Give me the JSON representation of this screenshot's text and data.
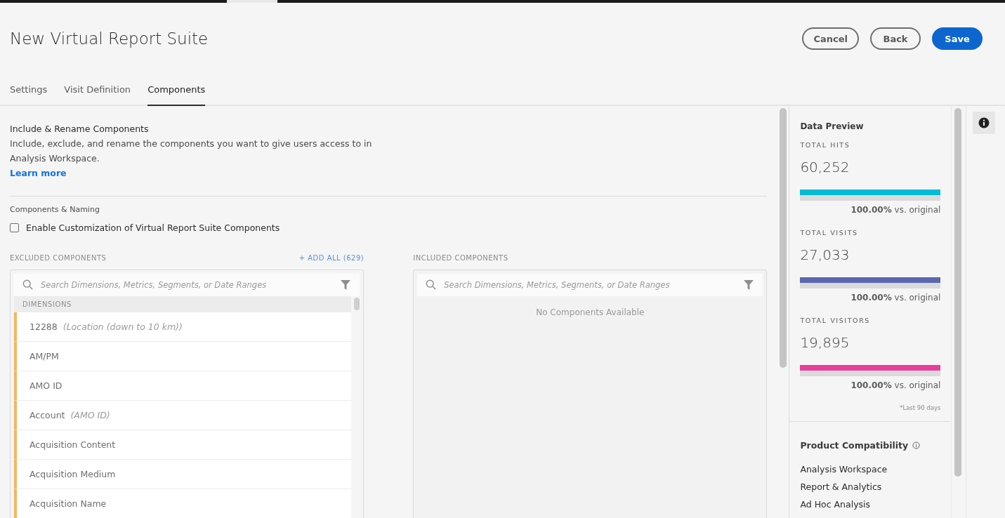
{
  "header": {
    "title": "New Virtual Report Suite",
    "buttons": [
      {
        "label": "Cancel",
        "kind": "secondary"
      },
      {
        "label": "Back",
        "kind": "secondary"
      },
      {
        "label": "Save",
        "kind": "primary"
      }
    ]
  },
  "tabs": [
    {
      "label": "Settings",
      "selected": false
    },
    {
      "label": "Visit Definition",
      "selected": false
    },
    {
      "label": "Components",
      "selected": true
    }
  ],
  "intro": {
    "heading": "Include & Rename Components",
    "description": "Include, exclude, and rename the components you want to give users access to in Analysis Workspace.",
    "link": "Learn more"
  },
  "naming": {
    "label": "Components & Naming",
    "checkbox": {
      "label": "Enable Customization of Virtual Report Suite Components",
      "checked": false
    }
  },
  "excluded": {
    "label": "EXCLUDED COMPONENTS",
    "add_all": "+ ADD ALL (629)",
    "placeholder": "Search Dimensions, Metrics, Segments, or Date Ranges",
    "group": "DIMENSIONS",
    "items": [
      {
        "name": "12288",
        "alias": "(Location (down to 10 km))"
      },
      {
        "name": "AM/PM"
      },
      {
        "name": "AMO ID"
      },
      {
        "name": "Account",
        "alias": "(AMO ID)"
      },
      {
        "name": "Acquisition Content"
      },
      {
        "name": "Acquisition Medium"
      },
      {
        "name": "Acquisition Name"
      }
    ]
  },
  "included": {
    "label": "INCLUDED COMPONENTS",
    "placeholder": "Search Dimensions, Metrics, Segments, or Date Ranges",
    "empty": "No Components Available"
  },
  "preview": {
    "title": "Data Preview",
    "metrics": [
      {
        "label": "TOTAL HITS",
        "value": "60,252",
        "level": 1,
        "color": "#00bcd4",
        "comparison": "**100.00%** vs. original"
      },
      {
        "label": "TOTAL VISITS",
        "value": "27,033",
        "level": 1,
        "color": "#5a67b0",
        "comparison": "**100.00%** vs. original"
      },
      {
        "label": "TOTAL VISITORS",
        "value": "19,895",
        "level": 1,
        "color": "#e83e9c",
        "comparison": "**100.00%** vs. original"
      }
    ],
    "footnote": "*Last 90 days"
  },
  "compatibility": {
    "title": "Product Compatibility",
    "items": [
      "Analysis Workspace",
      "Report & Analytics",
      "Ad Hoc Analysis"
    ]
  }
}
